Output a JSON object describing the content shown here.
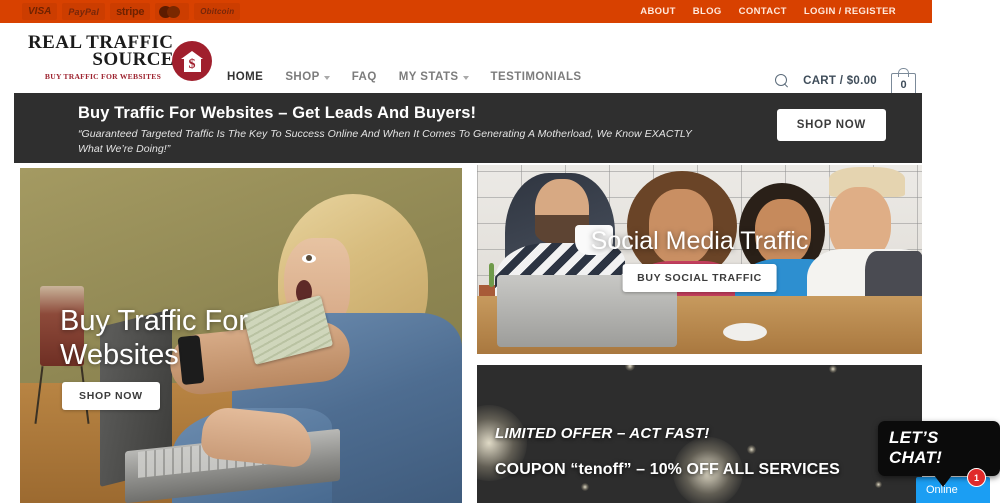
{
  "topbar": {
    "payment_badges": [
      {
        "name": "visa",
        "label": "VISA"
      },
      {
        "name": "paypal",
        "label": "PayPal"
      },
      {
        "name": "stripe",
        "label": "stripe"
      },
      {
        "name": "mastercard",
        "label": ""
      },
      {
        "name": "bitcoin",
        "label": "Obitcoin"
      }
    ],
    "links": [
      "ABOUT",
      "BLOG",
      "CONTACT",
      "LOGIN / REGISTER"
    ],
    "background": "#d84100"
  },
  "header": {
    "logo": {
      "line1": "REAL TRAFFIC",
      "line2": "SOURCE",
      "tagline": "BUY TRAFFIC FOR WEBSITES",
      "badge_symbol": "$",
      "badge_color": "#a01f2d"
    },
    "nav": [
      {
        "label": "HOME",
        "active": true,
        "dropdown": false
      },
      {
        "label": "SHOP",
        "active": false,
        "dropdown": true
      },
      {
        "label": "FAQ",
        "active": false,
        "dropdown": false
      },
      {
        "label": "MY STATS",
        "active": false,
        "dropdown": true
      },
      {
        "label": "TESTIMONIALS",
        "active": false,
        "dropdown": false
      }
    ],
    "cart": {
      "label": "CART / $0.00",
      "count": "0"
    }
  },
  "promo": {
    "heading": "Buy Traffic For Websites – Get Leads And Buyers!",
    "subheading": "“Guaranteed Targeted Traffic Is The Key To Success Online And When It Comes To Generating A Motherload, We Know EXACTLY What We’re Doing!”",
    "button": "SHOP NOW",
    "background": "#2f2f2f"
  },
  "cards": {
    "left": {
      "title": "Buy Traffic For Websites",
      "button": "SHOP NOW"
    },
    "social": {
      "title": "Social Media Traffic",
      "button": "BUY SOCIAL TRAFFIC"
    },
    "offer": {
      "line1": "LIMITED OFFER – ACT FAST!",
      "line2": "COUPON “tenoff” – 10% OFF ALL SERVICES",
      "background": "#2d2d2d"
    }
  },
  "chat": {
    "bubble": "LET’S CHAT!",
    "status": "Online",
    "badge": "1",
    "accent": "#1b9ef3",
    "badge_color": "#e02b2b"
  }
}
